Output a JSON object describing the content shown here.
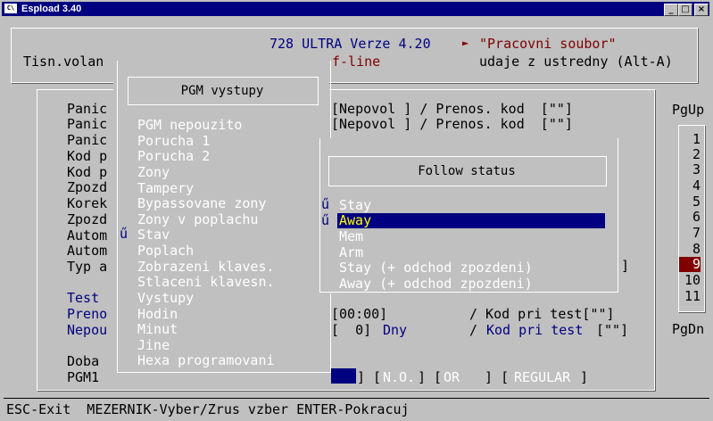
{
  "window": {
    "title": "Espload 3.40",
    "icon_text": "C\\",
    "min": "_",
    "max": "□",
    "close": "×"
  },
  "header": {
    "version": "728 ULTRA Verze 4.20",
    "arrow": "►",
    "work_file": "\"Pracovni soubor\"",
    "left_label": "Tisn.volan",
    "offline": "f-line",
    "source": "udaje z ustredny (Alt-A)"
  },
  "params": {
    "labels": [
      "Panic",
      "Panic",
      "Panic",
      "Kod p",
      "Kod p",
      "Zpozd",
      "Korek",
      "Zpozd",
      "Autom",
      "Autom",
      "Typ a"
    ],
    "blue_labels": [
      "Test",
      "Preno",
      "Nepou"
    ],
    "doba": "Doba",
    "pgm1": "PGM1",
    "row1": "[Nepovol ] / Prenos. kod  [\"\"]",
    "row2": "[Nepovol ] / Prenos. kod  [\"\"]",
    "typ_bracket": "]",
    "test_time": "[00:00]",
    "test_code": "/ Kod pri test[\"\"]",
    "days_val": "[  0]",
    "days_unit": "Dny",
    "nepou_slash": "/",
    "nepou_code": "Kod pri test",
    "nepou_bracket": "[\"\"]",
    "pgm_flags": [
      "] [",
      "N.O.",
      "] [",
      "OR  ",
      " ] [",
      "REGULAR",
      "]"
    ]
  },
  "pages": {
    "up": "PgUp",
    "down": "PgDn",
    "numbers": [
      "1",
      "2",
      "3",
      "4",
      "5",
      "6",
      "7",
      "8",
      "9",
      "10",
      "11"
    ],
    "selected": "9"
  },
  "pgm_menu": {
    "title": "PGM vystupy",
    "marker": "ű",
    "items": [
      "PGM nepouzito",
      "Porucha 1",
      "Porucha 2",
      "Zony",
      "Tampery",
      "Bypassovane zony",
      "Zony v poplachu",
      "Stav",
      "Poplach",
      "Zobrazeni klaves.",
      "Stlaceni klavesn.",
      "Vystupy",
      "Hodin",
      "Minut",
      "Jine",
      "Hexa programovani"
    ],
    "marked_index": 7
  },
  "follow": {
    "title": "Follow status",
    "marker": "ű",
    "items": [
      "Stay",
      "Away",
      "Mem",
      "Arm",
      "Stay (+ odchod zpozdeni)",
      "Away (+ odchod zpozdeni)"
    ],
    "selected_index": 1
  },
  "statusbar": {
    "text": "ESC-Exit  MEZERNIK-Vyber/Zrus vzber ENTER-Pokracuj"
  }
}
